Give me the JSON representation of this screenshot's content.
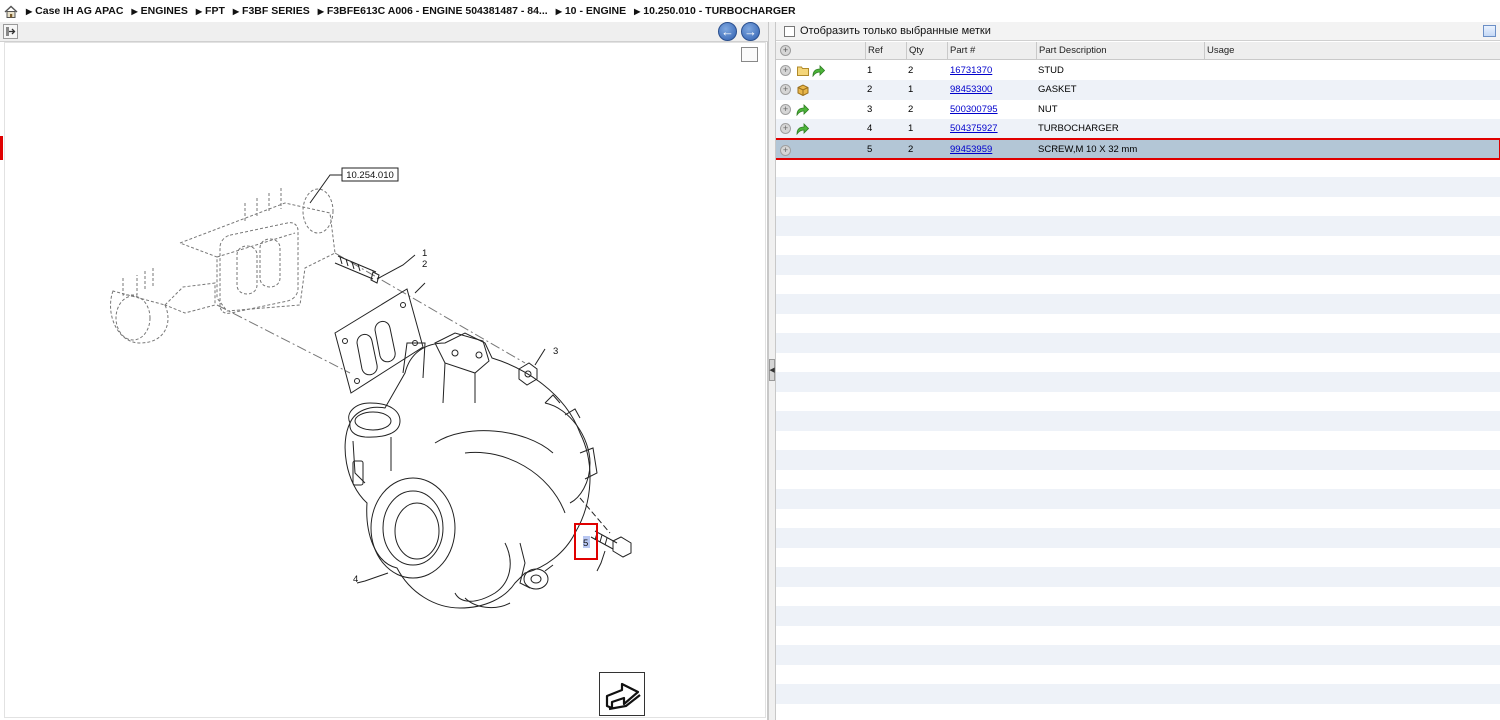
{
  "breadcrumb": {
    "home_icon": "home-icon",
    "items": [
      "Case IH AG APAC",
      "ENGINES",
      "FPT",
      "F3BF SERIES",
      "F3BFE613C A006 - ENGINE 504381487 - 84...",
      "10 - ENGINE",
      "10.250.010 - TURBOCHARGER"
    ]
  },
  "left_toolbar": {
    "expand_icon": "expand-arrow-icon",
    "back_icon": "arrow-left-icon",
    "forward_icon": "arrow-right-icon",
    "back_glyph": "←",
    "forward_glyph": "→"
  },
  "drawing": {
    "ref_box_label": "10.254.010",
    "callouts": [
      "1",
      "2",
      "3",
      "4",
      "5"
    ],
    "highlighted_callout": "5",
    "zoom_icon": "zoom-box-icon",
    "exit_icon": "exit-arrow-icon"
  },
  "right_pane": {
    "filter_label": "Отобразить только выбранные метки",
    "filter_checked": false,
    "settings_icon": "table-settings-icon",
    "columns": [
      "Ref",
      "Qty",
      "Part #",
      "Part Description",
      "Usage"
    ],
    "rows": [
      {
        "ref": "1",
        "qty": "2",
        "part": "16731370",
        "desc": "STUD",
        "usage": "",
        "icons": [
          "folder-icon",
          "green-arrow-icon"
        ],
        "selected": false
      },
      {
        "ref": "2",
        "qty": "1",
        "part": "98453300",
        "desc": "GASKET",
        "usage": "",
        "icons": [
          "box-icon"
        ],
        "selected": false
      },
      {
        "ref": "3",
        "qty": "2",
        "part": "500300795",
        "desc": "NUT",
        "usage": "",
        "icons": [
          "green-arrow-icon"
        ],
        "selected": false
      },
      {
        "ref": "4",
        "qty": "1",
        "part": "504375927",
        "desc": "TURBOCHARGER",
        "usage": "",
        "icons": [
          "green-arrow-icon"
        ],
        "selected": false
      },
      {
        "ref": "5",
        "qty": "2",
        "part": "99453959",
        "desc": "SCREW,M 10 X 32 mm",
        "usage": "",
        "icons": [],
        "selected": true
      }
    ]
  },
  "colors": {
    "highlight_red": "#e00000",
    "selected_row_bg": "#b3c6d6",
    "stripe_bg": "#eef2f8",
    "link_blue": "#0000cc",
    "nav_button_blue": "#2f5fb0"
  }
}
